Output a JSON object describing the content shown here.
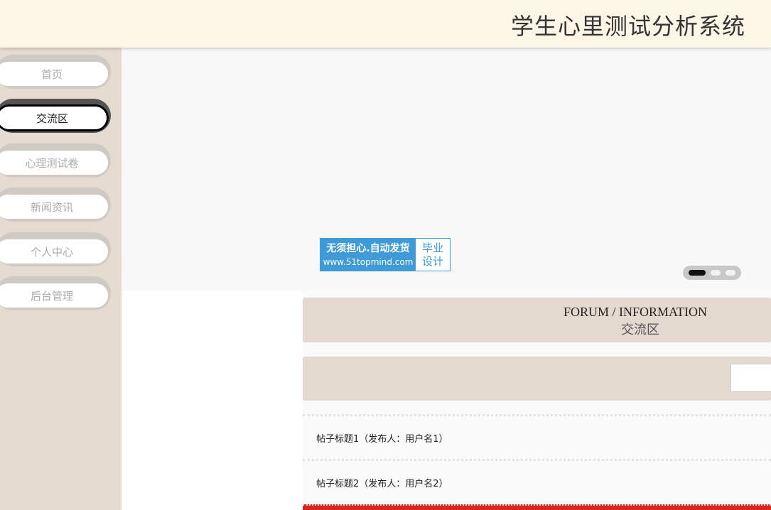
{
  "header": {
    "title": "学生心里测试分析系统"
  },
  "sidebar": {
    "items": [
      {
        "label": "首页",
        "active": false
      },
      {
        "label": "交流区",
        "active": true
      },
      {
        "label": "心理测试卷",
        "active": false
      },
      {
        "label": "新闻资讯",
        "active": false
      },
      {
        "label": "个人中心",
        "active": false
      },
      {
        "label": "后台管理",
        "active": false
      }
    ]
  },
  "banner": {
    "watermark": {
      "line1": "无须担心.自动发货",
      "line2": "www.51topmind.com",
      "side_line1": "毕业",
      "side_line2": "设计"
    },
    "carousel": {
      "slide_count": 3,
      "active_index": 0
    }
  },
  "section": {
    "title_en": "FORUM / INFORMATION",
    "title_cn": "交流区"
  },
  "search": {
    "value": ""
  },
  "posts": [
    {
      "label": "帖子标题1（发布人：用户名1）"
    },
    {
      "label": "帖子标题2（发布人：用户名2）"
    }
  ],
  "colors": {
    "header_bg": "#fdf5e6",
    "sidebar_bg": "#e6dbd1",
    "section_bg": "#e4d9ce",
    "watermark_blue": "#3f9ad8",
    "accent_red": "#d9261c"
  }
}
